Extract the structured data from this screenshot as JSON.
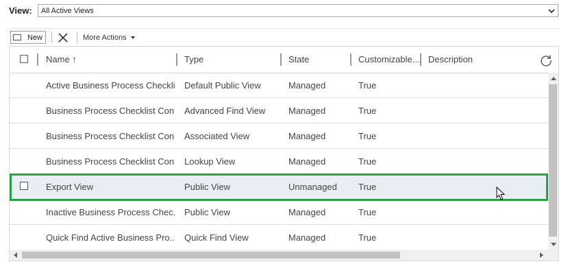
{
  "view": {
    "label": "View:",
    "selected": "All Active Views"
  },
  "toolbar": {
    "new_label": "New",
    "more_actions_label": "More Actions"
  },
  "grid": {
    "columns": [
      "Name ↑",
      "Type",
      "State",
      "Customizable...",
      "Description"
    ],
    "rows": [
      {
        "name": "Active Business Process Checkli...",
        "type": "Default Public View",
        "state": "Managed",
        "customizable": "True",
        "description": ""
      },
      {
        "name": "Business Process Checklist Con...",
        "type": "Advanced Find View",
        "state": "Managed",
        "customizable": "True",
        "description": ""
      },
      {
        "name": "Business Process Checklist Con...",
        "type": "Associated View",
        "state": "Managed",
        "customizable": "True",
        "description": ""
      },
      {
        "name": "Business Process Checklist Con...",
        "type": "Lookup View",
        "state": "Managed",
        "customizable": "True",
        "description": ""
      },
      {
        "name": "Export View",
        "type": "Public View",
        "state": "Unmanaged",
        "customizable": "True",
        "description": ""
      },
      {
        "name": "Inactive Business Process Chec...",
        "type": "Public View",
        "state": "Managed",
        "customizable": "True",
        "description": ""
      },
      {
        "name": "Quick Find Active Business Pro...",
        "type": "Quick Find View",
        "state": "Managed",
        "customizable": "True",
        "description": ""
      }
    ]
  },
  "colors": {
    "highlight": "#22a34a",
    "selected_row": "#e9eef4"
  },
  "icons": [
    "chevron-down-icon",
    "new-icon",
    "delete-icon",
    "caret-down-icon",
    "refresh-icon",
    "cursor-icon"
  ]
}
